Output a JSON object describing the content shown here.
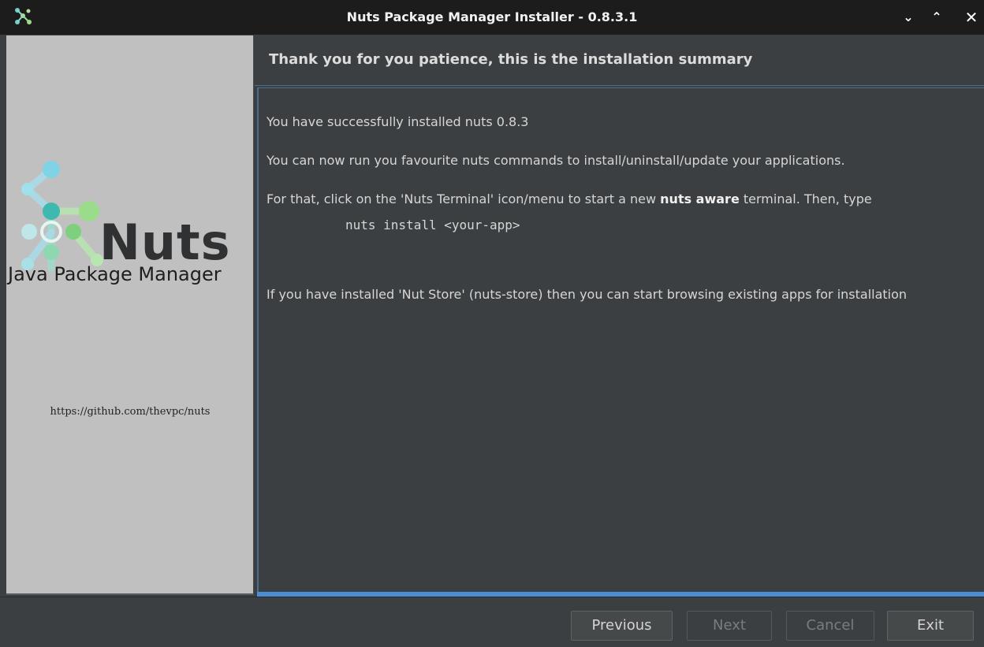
{
  "window": {
    "title": "Nuts Package Manager Installer - 0.8.3.1",
    "controls": {
      "minimize_icon": "chevron-down-icon",
      "maximize_icon": "chevron-up-icon",
      "close_icon": "close-icon"
    }
  },
  "sidebar": {
    "logo_text": "Nuts",
    "logo_subtitle": "Java Package Manager",
    "repo_url": "https://github.com/thevpc/nuts"
  },
  "main": {
    "header": "Thank you for you patience, this is the installation summary",
    "paragraphs": {
      "p1": "You have successfully installed nuts 0.8.3",
      "p2": "You can now run you favourite nuts commands to install/uninstall/update your applications.",
      "p3_before": "For that, click on the 'Nuts Terminal' icon/menu to start a new ",
      "p3_bold": "nuts aware",
      "p3_after": " terminal. Then, type",
      "command": "nuts install <your-app>",
      "p4": "If you have installed 'Nut Store' (nuts-store) then you can start browsing existing apps for installation"
    },
    "progress": 1.0
  },
  "footer": {
    "previous_label": "Previous",
    "next_label": "Next",
    "cancel_label": "Cancel",
    "exit_label": "Exit"
  },
  "colors": {
    "accent": "#4b8ed8",
    "logo_teal": "#3fb8b0",
    "logo_green": "#7ed07e"
  }
}
